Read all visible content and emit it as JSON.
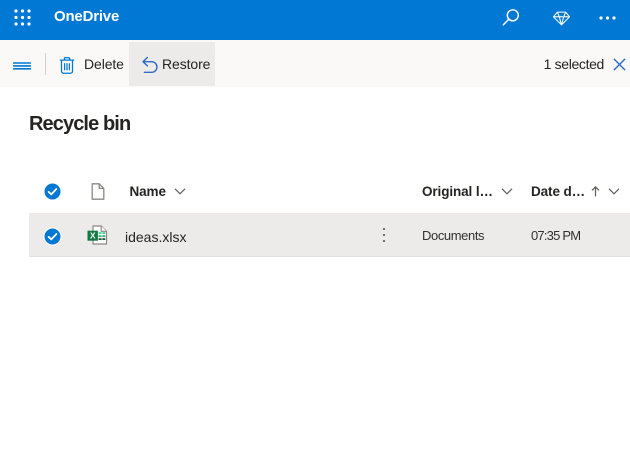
{
  "topbar": {
    "brand": "OneDrive",
    "colors": {
      "background": "#0078d4",
      "foreground": "#ffffff"
    }
  },
  "toolbar": {
    "delete_label": "Delete",
    "restore_label": "Restore",
    "selection_status": "1 selected",
    "colors": {
      "background": "#faf9f8",
      "active_button_background": "#edebe9",
      "icon_accent": "#0078d4"
    }
  },
  "page": {
    "title": "Recycle bin"
  },
  "list": {
    "columns": [
      {
        "label": "Name"
      },
      {
        "label": "Original l…"
      },
      {
        "label": "Date d…",
        "sort": "ascending"
      }
    ],
    "rows": [
      {
        "name": "ideas.xlsx",
        "file_type": "excel-workbook",
        "original_location": "Documents",
        "date_deleted": "07:35 PM",
        "selected": true
      }
    ],
    "colors": {
      "selected_row_background": "#edebe9",
      "checkbox_fill": "#0078d4"
    }
  }
}
